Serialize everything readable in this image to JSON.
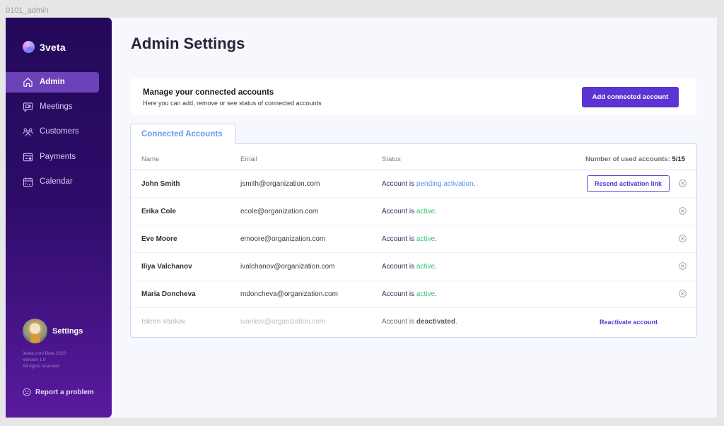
{
  "frame_label": "0101_admin",
  "app": {
    "logo_text": "3veta",
    "nav": [
      {
        "label": "Admin",
        "icon": "home-icon",
        "active": true
      },
      {
        "label": "Meetings",
        "icon": "meetings-icon",
        "active": false
      },
      {
        "label": "Customers",
        "icon": "customers-icon",
        "active": false
      },
      {
        "label": "Payments",
        "icon": "payments-icon",
        "active": false
      },
      {
        "label": "Calendar",
        "icon": "calendar-icon",
        "active": false
      }
    ],
    "profile_label": "Settings",
    "footer_info": [
      "3veta.com Beta 2020",
      "Version 1.0",
      "All rights reserved"
    ],
    "report_label": "Report a problem"
  },
  "page": {
    "title": "Admin Settings",
    "manage": {
      "title": "Manage your connected accounts",
      "subtitle": "Here you can add, remove or see status of connected accounts",
      "add_button": "Add connected account"
    },
    "tab_label": "Connected Accounts",
    "table": {
      "headers": {
        "name": "Name",
        "email": "Email",
        "status": "Status"
      },
      "count_label": "Number of used accounts:",
      "count_value": "5/15",
      "status_prefix": "Account is",
      "rows": [
        {
          "name": "John Smith",
          "email": "jsmith@organization.com",
          "status": "pending activation",
          "status_type": "pending",
          "action": "Resend activation link",
          "removable": true
        },
        {
          "name": "Erika Cole",
          "email": "ecole@organization.com",
          "status": "active",
          "status_type": "active",
          "action": "",
          "removable": true
        },
        {
          "name": "Eve Moore",
          "email": "emoore@organization.com",
          "status": "active",
          "status_type": "active",
          "action": "",
          "removable": true
        },
        {
          "name": "Iliya Valchanov",
          "email": "ivalchanov@organization.com",
          "status": "active",
          "status_type": "active",
          "action": "",
          "removable": true
        },
        {
          "name": "Maria Doncheva",
          "email": "mdoncheva@organization.com",
          "status": "active",
          "status_type": "active",
          "action": "",
          "removable": true
        },
        {
          "name": "Iskren Vankov",
          "email": "ivankov@organization.com",
          "status": "deactivated",
          "status_type": "deactivated",
          "action": "Reactivate account",
          "removable": false
        }
      ]
    }
  },
  "colors": {
    "brand": "#5a35d3",
    "sidebar_top": "#23095a",
    "sidebar_bottom": "#5a1a9e",
    "active": "#34c27a",
    "pending": "#5b8ff0"
  }
}
